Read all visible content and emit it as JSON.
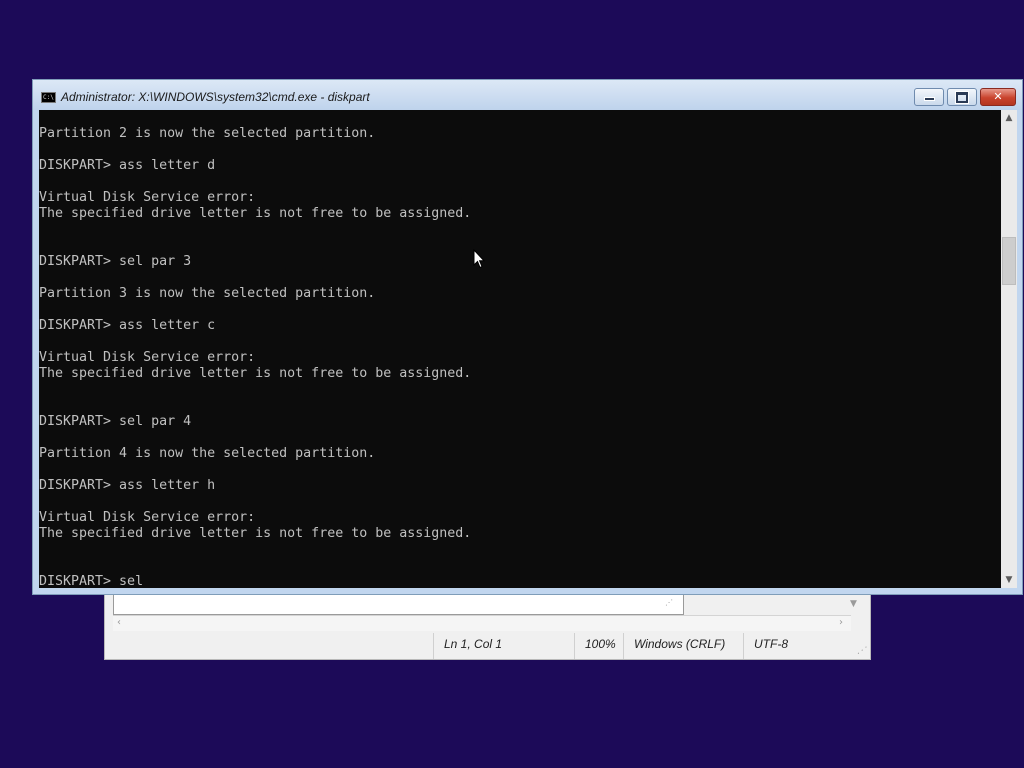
{
  "notepad": {
    "status": {
      "position": "Ln 1, Col 1",
      "zoom": "100%",
      "line_ending": "Windows (CRLF)",
      "encoding": "UTF-8"
    }
  },
  "cmd": {
    "title": "Administrator: X:\\WINDOWS\\system32\\cmd.exe - diskpart",
    "icon_text": "C:\\",
    "lines": [
      "Partition 2 is now the selected partition.",
      "",
      "DISKPART> ass letter d",
      "",
      "Virtual Disk Service error:",
      "The specified drive letter is not free to be assigned.",
      "",
      "",
      "DISKPART> sel par 3",
      "",
      "Partition 3 is now the selected partition.",
      "",
      "DISKPART> ass letter c",
      "",
      "Virtual Disk Service error:",
      "The specified drive letter is not free to be assigned.",
      "",
      "",
      "DISKPART> sel par 4",
      "",
      "Partition 4 is now the selected partition.",
      "",
      "DISKPART> ass letter h",
      "",
      "Virtual Disk Service error:",
      "The specified drive letter is not free to be assigned.",
      "",
      "",
      "DISKPART> sel"
    ]
  },
  "colors": {
    "desktop": "#1c0a58",
    "console_bg": "#0c0c0c",
    "console_text": "#c0c0c0",
    "close_button": "#c9432d"
  }
}
